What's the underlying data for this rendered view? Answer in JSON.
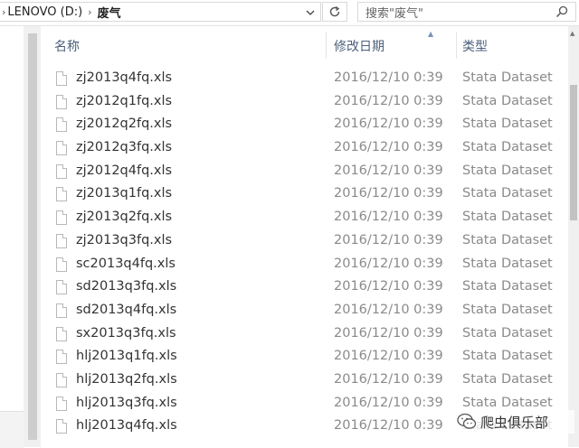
{
  "address": {
    "crumbs": [
      "LENOVO (D:)",
      "废气"
    ],
    "search_placeholder": "搜索\"废气\""
  },
  "columns": {
    "name": "名称",
    "date": "修改日期",
    "type": "类型"
  },
  "files": [
    {
      "name": "zj2013q4fq.xls",
      "date": "2016/12/10 0:39",
      "type": "Stata Dataset"
    },
    {
      "name": "zj2012q1fq.xls",
      "date": "2016/12/10 0:39",
      "type": "Stata Dataset"
    },
    {
      "name": "zj2012q2fq.xls",
      "date": "2016/12/10 0:39",
      "type": "Stata Dataset"
    },
    {
      "name": "zj2012q3fq.xls",
      "date": "2016/12/10 0:39",
      "type": "Stata Dataset"
    },
    {
      "name": "zj2012q4fq.xls",
      "date": "2016/12/10 0:39",
      "type": "Stata Dataset"
    },
    {
      "name": "zj2013q1fq.xls",
      "date": "2016/12/10 0:39",
      "type": "Stata Dataset"
    },
    {
      "name": "zj2013q2fq.xls",
      "date": "2016/12/10 0:39",
      "type": "Stata Dataset"
    },
    {
      "name": "zj2013q3fq.xls",
      "date": "2016/12/10 0:39",
      "type": "Stata Dataset"
    },
    {
      "name": "sc2013q4fq.xls",
      "date": "2016/12/10 0:39",
      "type": "Stata Dataset"
    },
    {
      "name": "sd2013q3fq.xls",
      "date": "2016/12/10 0:39",
      "type": "Stata Dataset"
    },
    {
      "name": "sd2013q4fq.xls",
      "date": "2016/12/10 0:39",
      "type": "Stata Dataset"
    },
    {
      "name": "sx2013q3fq.xls",
      "date": "2016/12/10 0:39",
      "type": "Stata Dataset"
    },
    {
      "name": "hlj2013q1fq.xls",
      "date": "2016/12/10 0:39",
      "type": "Stata Dataset"
    },
    {
      "name": "hlj2013q2fq.xls",
      "date": "2016/12/10 0:39",
      "type": "Stata Dataset"
    },
    {
      "name": "hlj2013q3fq.xls",
      "date": "2016/12/10 0:39",
      "type": "Stata Dataset"
    },
    {
      "name": "hlj2013q4fq.xls",
      "date": "2016/12/10 0:39",
      "type": "Stata Dataset"
    }
  ],
  "watermark": "爬虫俱乐部",
  "icons": {
    "crumb_separator": "chevron-right-icon",
    "dropdown": "chevron-down-icon",
    "refresh": "refresh-icon",
    "search": "search-icon",
    "file": "file-icon"
  }
}
